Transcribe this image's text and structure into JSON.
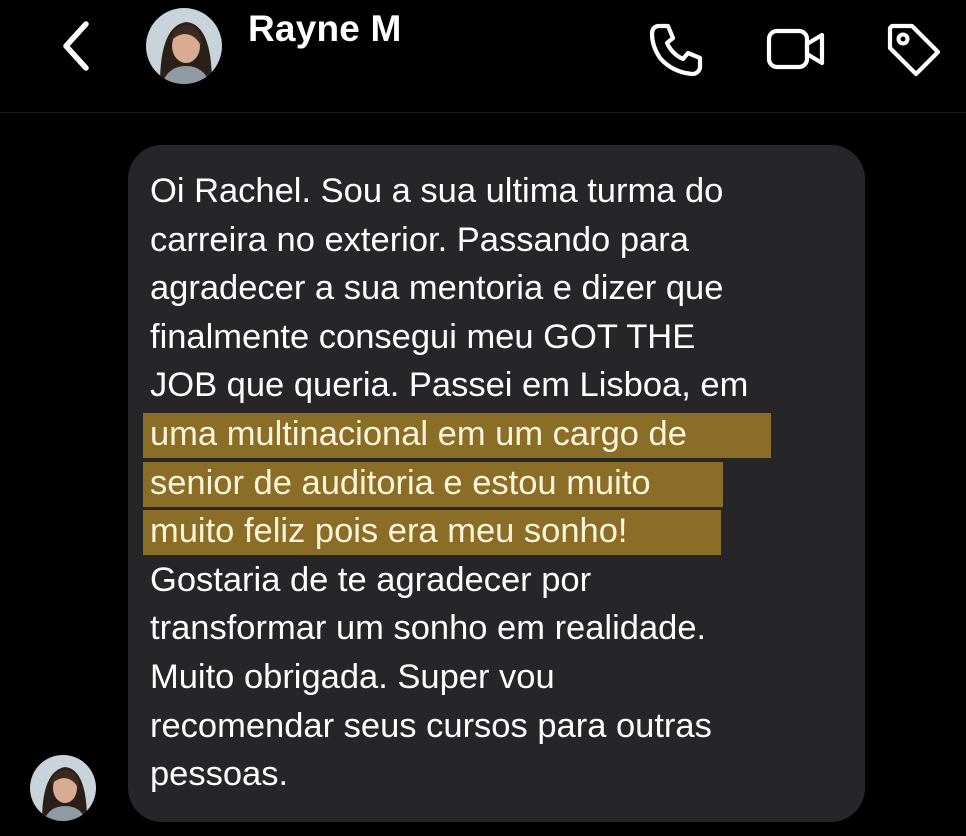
{
  "header": {
    "contact_name": "Rayne M",
    "icons": {
      "back": "chevron-left-icon",
      "call": "phone-icon",
      "video": "video-camera-icon",
      "tag": "tag-icon"
    }
  },
  "message": {
    "lines": [
      "Oi Rachel. Sou a sua ultima turma do",
      "carreira no exterior. Passando para",
      "agradecer a sua mentoria e dizer que",
      "finalmente consegui meu GOT THE",
      "JOB que queria. Passei em Lisboa, em"
    ],
    "highlighted_lines": [
      "uma multinacional em um cargo de",
      "senior de auditoria e estou muito",
      "muito feliz pois era meu sonho!"
    ],
    "trailing_lines": [
      "Gostaria de te agradecer por",
      "transformar um sonho em realidade.",
      "Muito obrigada. Super vou",
      "recomendar seus cursos para outras",
      "pessoas."
    ]
  },
  "colors": {
    "background": "#000000",
    "bubble": "#262628",
    "highlight": "#8a6d26",
    "text": "#ffffff"
  }
}
